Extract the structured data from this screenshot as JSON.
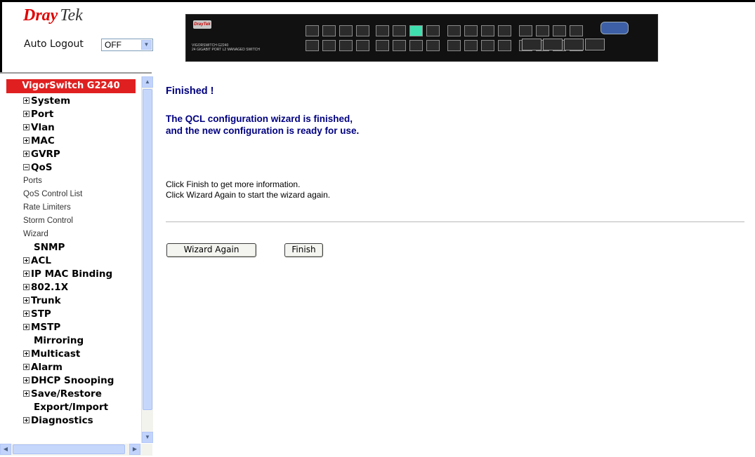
{
  "header": {
    "brand_red": "Dray",
    "brand_grey": "Tek",
    "auto_logout_label": "Auto Logout",
    "auto_logout_value": "OFF"
  },
  "sidebar": {
    "title": "VigorSwitch G2240",
    "items": [
      {
        "label": "System",
        "icon": "plus"
      },
      {
        "label": "Port",
        "icon": "plus"
      },
      {
        "label": "Vlan",
        "icon": "plus"
      },
      {
        "label": "MAC",
        "icon": "plus"
      },
      {
        "label": "GVRP",
        "icon": "plus"
      },
      {
        "label": "QoS",
        "icon": "minus",
        "children": [
          "Ports",
          "QoS Control List",
          "Rate Limiters",
          "Storm Control",
          "Wizard"
        ]
      },
      {
        "label": "SNMP",
        "icon": "none"
      },
      {
        "label": "ACL",
        "icon": "plus"
      },
      {
        "label": "IP MAC Binding",
        "icon": "plus"
      },
      {
        "label": "802.1X",
        "icon": "plus"
      },
      {
        "label": "Trunk",
        "icon": "plus"
      },
      {
        "label": "STP",
        "icon": "plus"
      },
      {
        "label": "MSTP",
        "icon": "plus"
      },
      {
        "label": "Mirroring",
        "icon": "none"
      },
      {
        "label": "Multicast",
        "icon": "plus"
      },
      {
        "label": "Alarm",
        "icon": "plus"
      },
      {
        "label": "DHCP Snooping",
        "icon": "plus"
      },
      {
        "label": "Save/Restore",
        "icon": "plus"
      },
      {
        "label": "Export/Import",
        "icon": "none"
      },
      {
        "label": "Diagnostics",
        "icon": "plus"
      }
    ]
  },
  "main": {
    "heading": "Finished !",
    "message_line1": "The QCL configuration wizard is finished,",
    "message_line2": "and the new configuration is ready for use.",
    "info_line1": "Click Finish to get more information.",
    "info_line2": "Click Wizard Again to start the wizard again.",
    "wizard_again_label": "Wizard Again",
    "finish_label": "Finish"
  },
  "colors": {
    "brand_red": "#e10000",
    "sidebar_title_bg": "#e02020",
    "heading_blue": "#000080",
    "scrollbar": "#c1d3fb"
  }
}
